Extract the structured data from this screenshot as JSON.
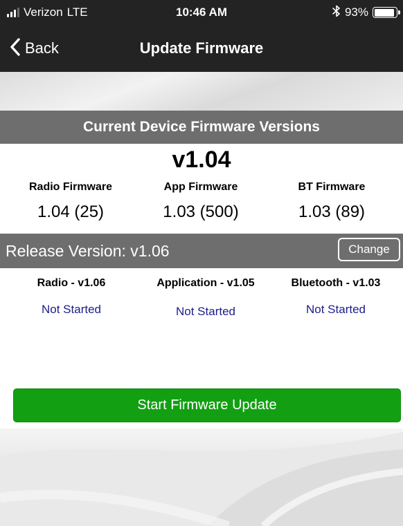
{
  "status_bar": {
    "carrier": "Verizon",
    "network": "LTE",
    "time": "10:46 AM",
    "battery_percent_label": "93%",
    "battery_level": 0.93,
    "bluetooth_icon": "bluetooth-icon",
    "signal_icon": "signal-bars-icon"
  },
  "nav": {
    "back_label": "Back",
    "back_icon": "chevron-left-icon",
    "title": "Update Firmware"
  },
  "current_section": {
    "title": "Current Device Firmware Versions",
    "device_version": "v1.04",
    "firmware": [
      {
        "label": "Radio Firmware",
        "value": "1.04 (25)"
      },
      {
        "label": "App Firmware",
        "value": "1.03 (500)"
      },
      {
        "label": "BT Firmware",
        "value": "1.03 (89)"
      }
    ]
  },
  "release": {
    "label": "Release Version: v1.06",
    "change_label": "Change",
    "updates": [
      {
        "label": "Radio - v1.06",
        "status": "Not Started"
      },
      {
        "label": "Application - v1.05",
        "status": "Not Started"
      },
      {
        "label": "Bluetooth - v1.03",
        "status": "Not Started"
      }
    ]
  },
  "actions": {
    "start_label": "Start Firmware Update"
  },
  "colors": {
    "status_bar_bg": "#232323",
    "header_gray": "#6e6e6e",
    "status_text_blue": "#1c1c8c",
    "start_button_green": "#12a012"
  }
}
